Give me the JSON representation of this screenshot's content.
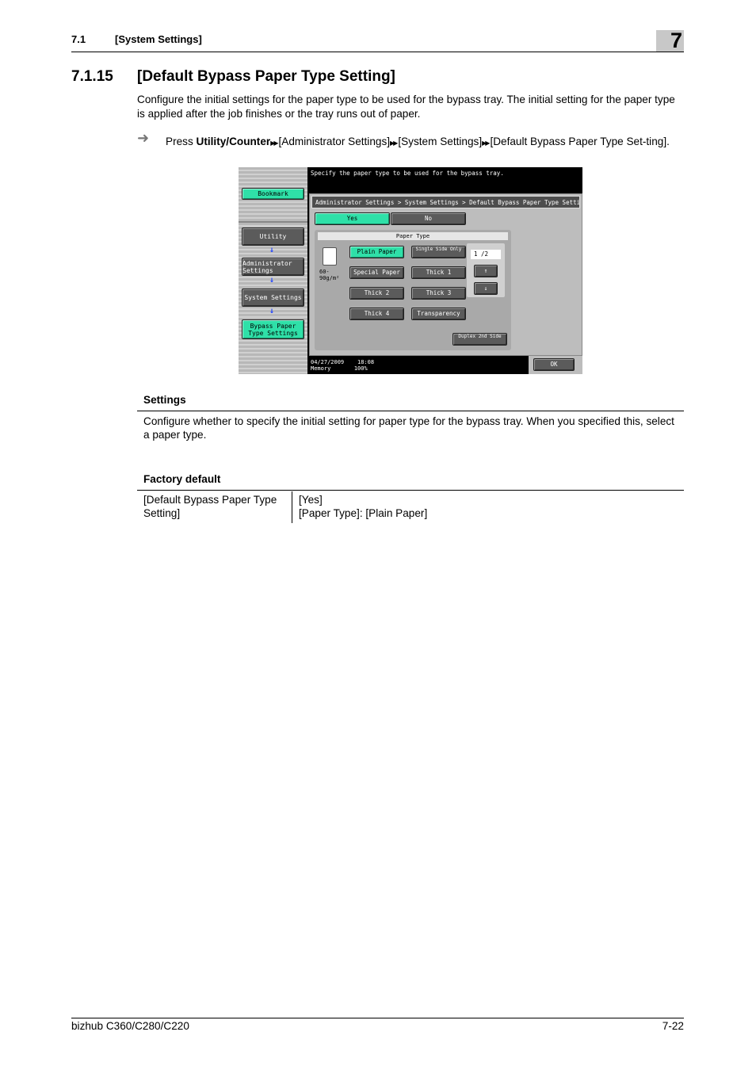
{
  "header": {
    "section_number": "7.1",
    "section_title": "[System Settings]",
    "chapter_number": "7"
  },
  "section": {
    "number": "7.1.15",
    "title": "[Default Bypass Paper Type Setting]",
    "intro": "Configure the initial settings for the paper type to be used for the bypass tray. The initial setting for the paper type is applied after the job finishes or the tray runs out of paper.",
    "step": {
      "press": "Press ",
      "key": "Utility/Counter",
      "path": [
        "[Administrator Settings]",
        "[System Settings]",
        "[Default Bypass Paper Type Set-ting]."
      ]
    }
  },
  "screen": {
    "message": "Specify the paper type to be used for the bypass tray.",
    "left_nav": {
      "bookmark": "Bookmark",
      "items": [
        "Utility",
        "Administrator Settings",
        "System Settings",
        "Bypass Paper Type Settings"
      ]
    },
    "breadcrumb": "Administrator Settings > System Settings > Default Bypass Paper Type Setting",
    "toggle": {
      "yes": "Yes",
      "no": "No",
      "selected": "Yes"
    },
    "paper_type_header": "Paper Type",
    "paper_weight": "60-\n90g/m²",
    "paper_buttons": [
      "Plain Paper",
      "Single Side Only",
      "Special Paper",
      "Thick 1",
      "Thick 2",
      "Thick 3",
      "Thick 4",
      "Transparency"
    ],
    "selected_paper": "Plain Paper",
    "duplex_button": "Duplex 2nd Side",
    "pager": "1 /2",
    "date": "04/27/2009",
    "time": "18:08",
    "memory_label": "Memory",
    "memory_value": "100%",
    "ok": "OK"
  },
  "settings": {
    "heading": "Settings",
    "text": "Configure whether to specify the initial setting for paper type for the bypass tray. When you specified this, select a paper type."
  },
  "factory_default": {
    "heading": "Factory default",
    "rows": [
      {
        "item": "[Default Bypass Paper Type Setting]",
        "value_lines": [
          "[Yes]",
          "[Paper Type]: [Plain Paper]"
        ]
      }
    ]
  },
  "footer": {
    "product": "bizhub C360/C280/C220",
    "page": "7-22"
  }
}
